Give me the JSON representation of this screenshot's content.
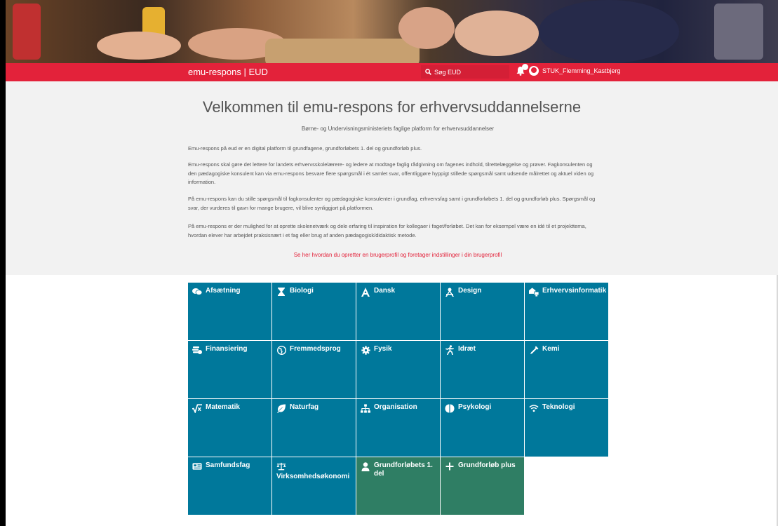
{
  "header": {
    "brand": "emu-respons | EUD",
    "search_placeholder": "Søg EUD",
    "username": "STUK_Flemming_Kastbjerg"
  },
  "intro": {
    "title": "Velkommen til emu-respons for erhvervsuddannelserne",
    "subtitle": "Børne- og Undervisningsministeriets faglige platform for erhvervsuddannelser",
    "paragraphs": [
      "Emu-respons på eud er en digital platform til grundfagene, grundforløbets 1. del og grundforløb plus.",
      "Emu-respons skal gøre det lettere for landets erhvervsskolelærere- og ledere at modtage faglig rådgivning om fagenes indhold, tilrettelæggelse og prøver. Fagkonsulenten og den pædagogiske konsulent kan via emu-respons besvare flere spørgsmål i ét samlet svar, offentliggøre hyppigt stillede spørgsmål samt udsende målrettet og aktuel viden og information.",
      "På emu-respons kan du stille spørgsmål til fagkonsulenter og pædagogiske konsulenter i grundfag, erhvervsfag samt i grundforløbets 1. del og grundforløb plus. Spørgsmål og svar, der vurderes til gavn for mange brugere, vil blive synliggjort på platformen.",
      "På emu-respons er der mulighed for at oprette skolenetværk og dele erfaring til inspiration for kollegaer i faget/forløbet. Det kan for eksempel være en idé til et projekttema, hvordan elever har arbejdet praksisnært i et fag eller brug af anden pædagogisk/didaktisk metode."
    ],
    "link": "Se her hvordan du opretter en brugerprofil og foretager indstillinger i din brugerprofil"
  },
  "tiles": [
    {
      "label": "Afsætning",
      "icon": "chat-bubbles-icon"
    },
    {
      "label": "Biologi",
      "icon": "hourglass-icon"
    },
    {
      "label": "Dansk",
      "icon": "letter-a-icon"
    },
    {
      "label": "Design",
      "icon": "drafting-icon"
    },
    {
      "label": "Erhvervsinformatik",
      "icon": "network-house-icon"
    },
    {
      "label": "Finansiering",
      "icon": "coins-icon"
    },
    {
      "label": "Fremmedsprog",
      "icon": "globe-icon"
    },
    {
      "label": "Fysik",
      "icon": "gear-icon"
    },
    {
      "label": "Idræt",
      "icon": "runner-icon"
    },
    {
      "label": "Kemi",
      "icon": "pipette-icon"
    },
    {
      "label": "Matematik",
      "icon": "square-root-icon"
    },
    {
      "label": "Naturfag",
      "icon": "leaf-icon"
    },
    {
      "label": "Organisation",
      "icon": "org-chart-icon"
    },
    {
      "label": "Psykologi",
      "icon": "brain-icon"
    },
    {
      "label": "Teknologi",
      "icon": "wifi-icon"
    },
    {
      "label": "Samfundsfag",
      "icon": "newspaper-icon"
    },
    {
      "label": "Virksomhedsøkonomi",
      "icon": "scale-icon"
    },
    {
      "label": "Grundforløbets 1. del",
      "icon": "person-icon"
    },
    {
      "label": "Grundforløb plus",
      "icon": "plus-icon"
    }
  ],
  "colors": {
    "accent_red": "#e3223a",
    "tile_blue": "#00789b",
    "tile_green": "#2f7e64"
  }
}
